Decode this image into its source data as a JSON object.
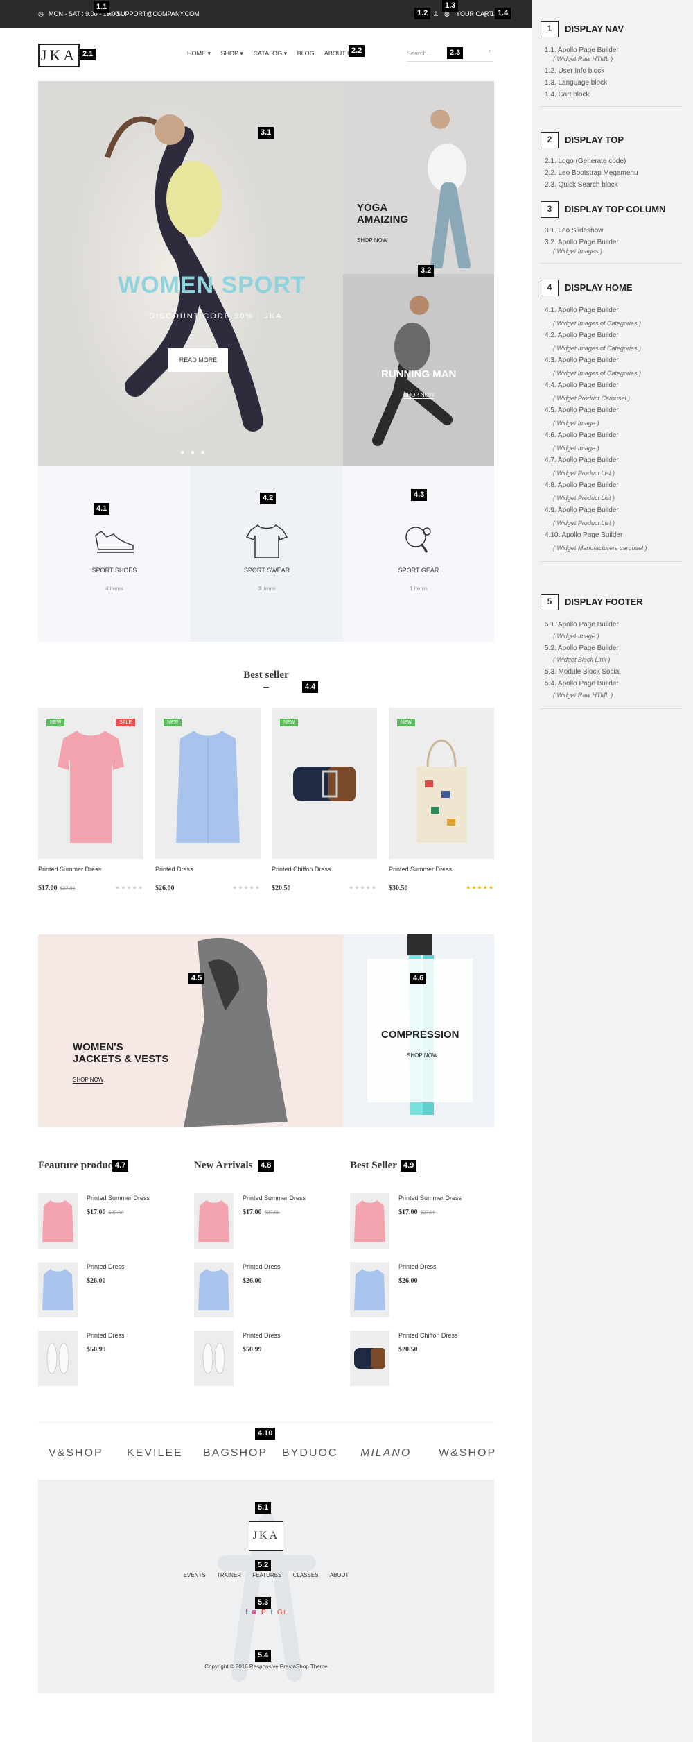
{
  "topbar": {
    "hours": "MON - SAT : 9.00 - 18.00",
    "email": "SUPPORT@COMPANY.COM",
    "cart": "YOUR CART",
    "cart_count": "1"
  },
  "tags": {
    "t11": "1.1",
    "t12": "1.2",
    "t13": "1.3",
    "t14": "1.4",
    "t21": "2.1",
    "t22": "2.2",
    "t23": "2.3",
    "t31": "3.1",
    "t32": "3.2",
    "t41": "4.1",
    "t42": "4.2",
    "t43": "4.3",
    "t44": "4.4",
    "t45": "4.5",
    "t46": "4.6",
    "t47": "4.7",
    "t48": "4.8",
    "t49": "4.9",
    "t410": "4.10",
    "t51": "5.1",
    "t52": "5.2",
    "t53": "5.3",
    "t54": "5.4"
  },
  "header": {
    "logo": "JKA",
    "menu": [
      "HOME ▾",
      "SHOP ▾",
      "CATALOG ▾",
      "BLOG",
      "ABOUT US"
    ],
    "search_placeholder": "Search..."
  },
  "hero": {
    "title": "WOMEN SPORT",
    "subtitle": "DISCOUNT CODE 90% : JKA",
    "button": "READ MORE"
  },
  "side_banners": [
    {
      "title": "YOGA\nAMAIZING",
      "link": "SHOP NOW"
    },
    {
      "title": "RUNNING MAN",
      "link": "SHOP NOW"
    }
  ],
  "categories": [
    {
      "name": "SPORT SHOES",
      "count": "4 items"
    },
    {
      "name": "SPORT SWEAR",
      "count": "3 items"
    },
    {
      "name": "SPORT GEAR",
      "count": "1 items"
    }
  ],
  "best_seller": {
    "title": "Best seller",
    "products": [
      {
        "name": "Printed Summer Dress",
        "price": "$17.00",
        "old": "$27.00",
        "new": "NEW",
        "sale": "SALE",
        "stars": "★★★★★",
        "rating": 0
      },
      {
        "name": "Printed Dress",
        "price": "$26.00",
        "old": "",
        "new": "NEW",
        "sale": "",
        "stars": "★★★★★",
        "rating": 0
      },
      {
        "name": "Printed Chiffon Dress",
        "price": "$20.50",
        "old": "",
        "new": "NEW",
        "sale": "",
        "stars": "★★★★★",
        "rating": 0
      },
      {
        "name": "Printed Summer Dress",
        "price": "$30.50",
        "old": "",
        "new": "NEW",
        "sale": "",
        "stars": "★★★★★",
        "rating": 5
      }
    ]
  },
  "promo": {
    "left": {
      "title": "WOMEN'S\nJACKETS & VESTS",
      "link": "SHOP NOW"
    },
    "right": {
      "title": "COMPRESSION",
      "link": "SHOP NOW"
    }
  },
  "columns": [
    {
      "title": "Feauture product",
      "items": [
        {
          "name": "Printed Summer Dress",
          "price": "$17.00",
          "old": "$27.00"
        },
        {
          "name": "Printed Dress",
          "price": "$26.00",
          "old": ""
        },
        {
          "name": "Printed Dress",
          "price": "$50.99",
          "old": ""
        }
      ]
    },
    {
      "title": "New Arrivals",
      "items": [
        {
          "name": "Printed Summer Dress",
          "price": "$17.00",
          "old": "$27.00"
        },
        {
          "name": "Printed Dress",
          "price": "$26.00",
          "old": ""
        },
        {
          "name": "Printed Dress",
          "price": "$50.99",
          "old": ""
        }
      ]
    },
    {
      "title": "Best Seller",
      "items": [
        {
          "name": "Printed Summer Dress",
          "price": "$17.00",
          "old": "$27.00"
        },
        {
          "name": "Printed Dress",
          "price": "$26.00",
          "old": ""
        },
        {
          "name": "Printed Chiffon Dress",
          "price": "$20.50",
          "old": ""
        }
      ]
    }
  ],
  "brands": [
    "V&SHOP",
    "KEVILEE",
    "BAGSHOP",
    "BYDUOC",
    "MILANO",
    "W&SHOP"
  ],
  "footer": {
    "logo": "JKA",
    "links": [
      "EVENTS",
      "TRAINER",
      "FEATURES",
      "CLASSES",
      "ABOUT"
    ],
    "social": [
      "f",
      "◙",
      "P",
      "t",
      "G+"
    ],
    "copyright": "Copyright © 2016 Responsive PrestaShop Theme"
  },
  "doc": {
    "s1": {
      "num": "1",
      "title": "DISPLAY NAV",
      "items": [
        {
          "t": "1.1. Apollo Page Builder",
          "s": "( Widget Raw HTML )"
        },
        {
          "t": "1.2. User Info block",
          "s": ""
        },
        {
          "t": "1.3. Language block",
          "s": ""
        },
        {
          "t": "1.4. Cart block",
          "s": ""
        }
      ]
    },
    "s2": {
      "num": "2",
      "title": "DISPLAY TOP",
      "items": [
        {
          "t": "2.1. Logo (Generate code)",
          "s": ""
        },
        {
          "t": "2.2. Leo Bootstrap Megamenu",
          "s": ""
        },
        {
          "t": "2.3. Quick Search block",
          "s": ""
        }
      ]
    },
    "s3": {
      "num": "3",
      "title": "DISPLAY TOP COLUMN",
      "items": [
        {
          "t": "3.1. Leo Slideshow",
          "s": ""
        },
        {
          "t": "3.2. Apollo Page Builder",
          "s": "( Widget Images )"
        }
      ]
    },
    "s4": {
      "num": "4",
      "title": "DISPLAY HOME",
      "items": [
        {
          "t": "4.1. Apollo Page Builder",
          "s": "( Widget Images of Categories )"
        },
        {
          "t": "4.2. Apollo Page Builder",
          "s": "( Widget Images of Categories )"
        },
        {
          "t": "4.3. Apollo Page Builder",
          "s": "( Widget Images of Categories )"
        },
        {
          "t": "4.4. Apollo Page Builder",
          "s": "( Widget Product Carousel )"
        },
        {
          "t": "4.5. Apollo Page Builder",
          "s": "( Widget Image )"
        },
        {
          "t": "4.6. Apollo Page Builder",
          "s": "( Widget Image )"
        },
        {
          "t": "4.7. Apollo Page Builder",
          "s": "( Widget Product List )"
        },
        {
          "t": "4.8. Apollo Page Builder",
          "s": "( Widget Product List )"
        },
        {
          "t": "4.9. Apollo Page Builder",
          "s": "( Widget Product List )"
        },
        {
          "t": "4.10. Apollo Page Builder",
          "s": "( Widget Manufacturers carousel )"
        }
      ]
    },
    "s5": {
      "num": "5",
      "title": "DISPLAY FOOTER",
      "items": [
        {
          "t": "5.1. Apollo Page Builder",
          "s": "( Widget Image )"
        },
        {
          "t": "5.2. Apollo Page Builder",
          "s": "( Widget Block Link )"
        },
        {
          "t": "5.3. Module Block Social",
          "s": ""
        },
        {
          "t": "5.4. Apollo Page Builder",
          "s": "( Widget Raw HTML )"
        }
      ]
    }
  },
  "colors": {
    "topbar": "#2b2b2b",
    "hero_title": "#8fd3dd",
    "new_badge": "#5cb85c",
    "sale_badge": "#e94d4d",
    "star_active": "#f0b400",
    "panel": "#f2f2f2"
  }
}
